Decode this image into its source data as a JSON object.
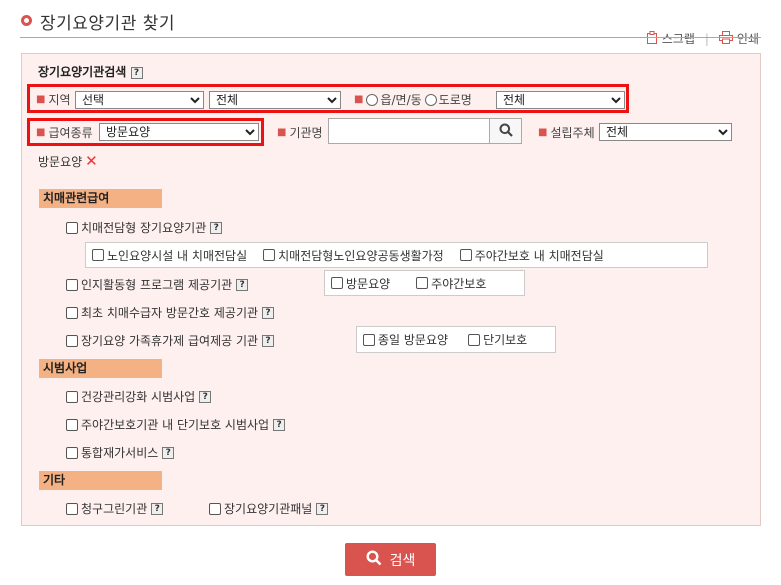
{
  "page": {
    "title": "장기요양기관 찾기",
    "scrap_label": "스크랩",
    "print_label": "인쇄",
    "separator": "|"
  },
  "search": {
    "title": "장기요양기관검색",
    "help": "?",
    "region_label": "지역",
    "region_select": "선택",
    "district_select": "전체",
    "town_label": "읍/면/동",
    "road_label": "도로명",
    "road_select": "전체",
    "benefit_label": "급여종류",
    "benefit_select": "방문요양",
    "org_name_label": "기관명",
    "org_name_value": "",
    "founder_label": "설립주체",
    "founder_select": "전체",
    "selected_chip": "방문요양",
    "chip_remove": "✕",
    "button_label": "검색"
  },
  "dementia": {
    "header": "치매관련급여",
    "items": {
      "dedicated": "치매전담형 장기요양기관",
      "sub1": "노인요양시설 내 치매전담실",
      "sub2": "치매전담형노인요양공동생활가정",
      "sub3": "주야간보호 내 치매전담실",
      "cognitive": "인지활동형 프로그램 제공기관",
      "cog_sub1": "방문요양",
      "cog_sub2": "주야간보호",
      "nurse": "최초 치매수급자 방문간호 제공기관",
      "family": "장기요양 가족휴가제 급여제공 기관",
      "fam_sub1": "종일 방문요양",
      "fam_sub2": "단기보호"
    }
  },
  "pilot": {
    "header": "시범사업",
    "items": {
      "health": "건강관리강화 시범사업",
      "shortterm": "주야간보호기관 내 단기보호 시범사업",
      "integrated": "통합재가서비스"
    }
  },
  "etc": {
    "header": "기타",
    "items": {
      "clean": "청구그린기관",
      "panel": "장기요양기관패널"
    }
  },
  "colors": {
    "accent": "#d9534f",
    "panel_bg": "#fdf0ee",
    "section_bg": "#f4b183",
    "highlight_border": "#ee1111"
  }
}
